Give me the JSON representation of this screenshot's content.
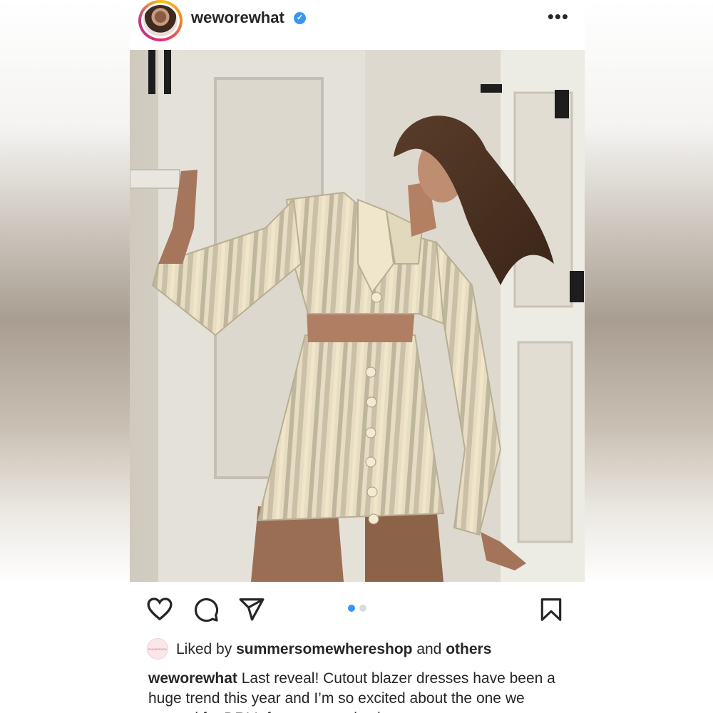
{
  "post": {
    "username": "weworewhat",
    "verified_icon": "verified-badge-icon",
    "more_icon": "more-options-icon"
  },
  "actions": {
    "like_icon": "heart-icon",
    "comment_icon": "comment-icon",
    "share_icon": "send-icon",
    "save_icon": "bookmark-icon"
  },
  "carousel": {
    "total": 2,
    "active_index": 0,
    "active_color": "#3897f0",
    "inactive_color": "#dbdbdb"
  },
  "likes": {
    "prefix": "Liked by",
    "user": "summersomewhereshop",
    "connector": "and",
    "others": "others",
    "avatar_text": "SUMMERSOMEWHERE"
  },
  "caption": {
    "username": "weworewhat",
    "text": "Last reveal! Cutout blazer dresses have been a huge trend this year and I’m so excited about the one we created for DR! It features an elastic"
  },
  "colors": {
    "text": "#262626",
    "accent": "#3897f0"
  }
}
